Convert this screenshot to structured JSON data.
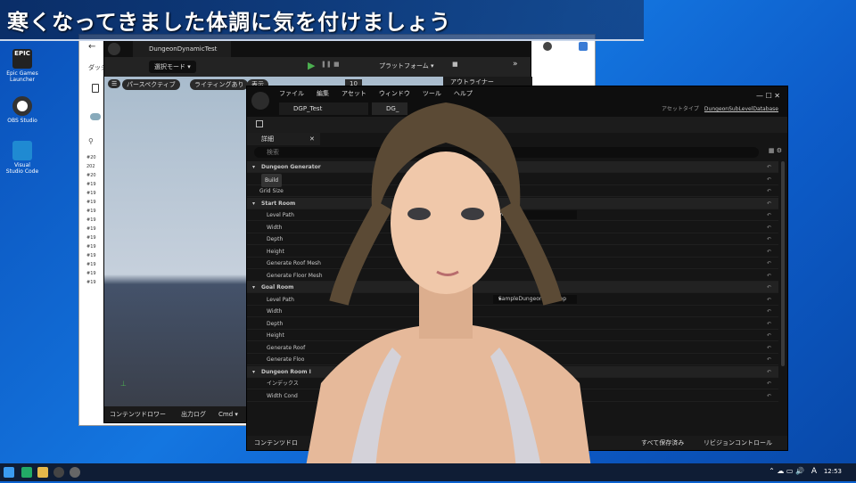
{
  "banner": {
    "text": "寒くなってきました体調に気を付けましょう"
  },
  "desktop": {
    "icons": [
      {
        "label": "Epic Games Launcher",
        "name": "epic-games-icon"
      },
      {
        "label": "OBS Studio",
        "name": "obs-icon"
      },
      {
        "label": "Visual Studio Code",
        "name": "vscode-icon"
      }
    ]
  },
  "browser": {
    "tab": "ダッシ",
    "list": [
      "#20",
      "202",
      "#20",
      "#19",
      "#19",
      "#19",
      "#19",
      "#19",
      "#19",
      "#19",
      "#19",
      "#19",
      "#19",
      "#19",
      "#19"
    ]
  },
  "ue1": {
    "title": "DungeonDynamicTest",
    "mode": "選択モード",
    "platform": "プラットフォーム",
    "perspective": "パースペクティブ",
    "lighting": "ライティングあり",
    "show": "表示",
    "outliner": "アウトライナー",
    "grid": "10",
    "bottom": [
      "コンテンツドロワー",
      "出力ログ",
      "Cmd"
    ]
  },
  "ue2": {
    "menu": [
      "ファイル",
      "編集",
      "アセット",
      "ウィンドウ",
      "ツール",
      "ヘルプ"
    ],
    "tabs": [
      "DGP_Test",
      "DG_"
    ],
    "asset_type_label": "アセットタイプ",
    "asset_type": "DungeonSubLevelDatabase",
    "panel": "詳細",
    "search": "検索",
    "rows": [
      {
        "t": "section",
        "label": "Dungeon Generator"
      },
      {
        "t": "button",
        "label": "Build"
      },
      {
        "t": "prop",
        "label": "Grid Size"
      },
      {
        "t": "section",
        "label": "Start Room"
      },
      {
        "t": "propval",
        "label": "Level Path",
        "value": "Map"
      },
      {
        "t": "prop",
        "label": "Width"
      },
      {
        "t": "prop",
        "label": "Depth"
      },
      {
        "t": "prop",
        "label": "Height"
      },
      {
        "t": "prop",
        "label": "Generate Roof Mesh"
      },
      {
        "t": "prop",
        "label": "Generate Floor Mesh"
      },
      {
        "t": "section",
        "label": "Goal Room"
      },
      {
        "t": "propval",
        "label": "Level Path",
        "value": "SampleDungeonGoalMap"
      },
      {
        "t": "prop",
        "label": "Width"
      },
      {
        "t": "prop",
        "label": "Depth"
      },
      {
        "t": "prop",
        "label": "Height"
      },
      {
        "t": "prop",
        "label": "Generate Roof"
      },
      {
        "t": "prop",
        "label": "Generate Floo"
      },
      {
        "t": "section",
        "label": "Dungeon Room I"
      },
      {
        "t": "prop",
        "label": "インデックス"
      },
      {
        "t": "prop",
        "label": "Width Cond"
      }
    ],
    "footer": [
      "コンテンツドロ",
      "すべて保存済み",
      "リビジョンコントロール"
    ]
  },
  "taskbar": {
    "time": "12:53",
    "ime": "A"
  }
}
